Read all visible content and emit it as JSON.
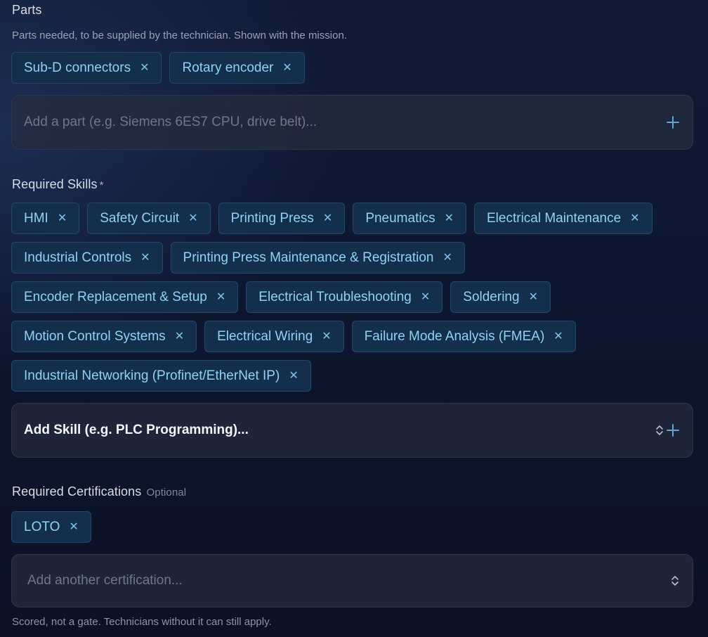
{
  "parts": {
    "title": "Parts",
    "hint": "Parts needed, to be supplied by the technician. Shown with the mission.",
    "chips": [
      {
        "label": "Sub-D connectors"
      },
      {
        "label": "Rotary encoder"
      }
    ],
    "input_placeholder": "Add a part (e.g. Siemens 6ES7 CPU, drive belt)..."
  },
  "skills": {
    "title": "Required Skills",
    "required_marker": "*",
    "chips": [
      {
        "label": "HMI"
      },
      {
        "label": "Safety Circuit"
      },
      {
        "label": "Printing Press"
      },
      {
        "label": "Pneumatics"
      },
      {
        "label": "Electrical Maintenance"
      },
      {
        "label": "Industrial Controls"
      },
      {
        "label": "Printing Press Maintenance & Registration"
      },
      {
        "label": "Encoder Replacement & Setup"
      },
      {
        "label": "Electrical Troubleshooting"
      },
      {
        "label": "Soldering"
      },
      {
        "label": "Motion Control Systems"
      },
      {
        "label": "Electrical Wiring"
      },
      {
        "label": "Failure Mode Analysis (FMEA)"
      },
      {
        "label": "Industrial Networking (Profinet/EtherNet IP)"
      }
    ],
    "select_label": "Add Skill (e.g. PLC Programming)..."
  },
  "certifications": {
    "title": "Required Certifications",
    "optional_label": "Optional",
    "chips": [
      {
        "label": "LOTO"
      }
    ],
    "input_placeholder": "Add another certification...",
    "note": "Scored, not a gate. Technicians without it can still apply."
  },
  "icons": {
    "remove": "close-icon",
    "add": "plus-icon",
    "select": "chevron-up-down-icon"
  },
  "colors": {
    "chip_bg": "#132f4b",
    "chip_text": "#8fd2f4",
    "accent_plus": "#5aa9d6"
  }
}
